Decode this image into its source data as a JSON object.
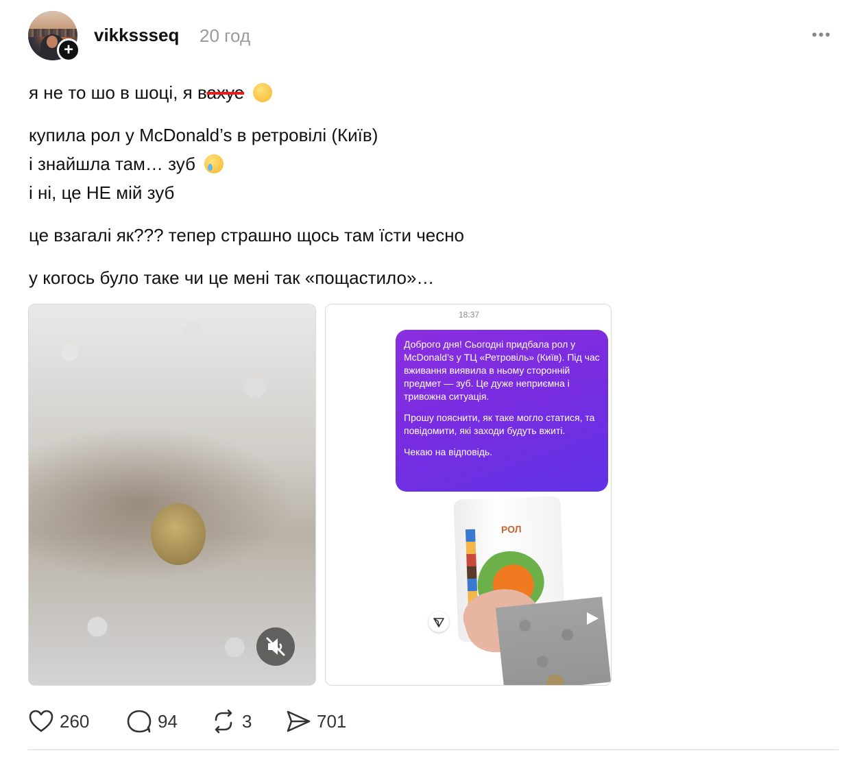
{
  "post": {
    "username": "vikkssseq",
    "timestamp": "20 год",
    "more_label": "•••",
    "follow_label": "+",
    "line1_before": "я не то шо в шоці, я в",
    "line1_struck": "ахуе",
    "line2": "купила рол у McDonald’s в ретровілі (Київ)",
    "line3": "і знайшла там… зуб",
    "line4": "і ні, це НЕ мій зуб",
    "line5": "це взагалі як??? тепер страшно щось там їсти чесно",
    "line6": "у когось було таке чи це мені так «пощастило»…"
  },
  "media": {
    "chat_time": "18:37",
    "message_paragraphs": [
      "Доброго дня! Сьогодні придбала рол у McDonald’s у ТЦ «Ретровіль» (Київ). Під час вживання виявила в ньому сторонній предмет — зуб. Це дуже неприємна і тривожна ситуація.",
      "Прошу пояснити, як таке могло статися, та повідомити, які заходи будуть вжиті.",
      "Чекаю на відповідь."
    ],
    "box_label": "РОЛ"
  },
  "actions": {
    "likes": "260",
    "replies": "94",
    "reposts": "3",
    "shares": "701"
  },
  "colors": {
    "bubble_purple": "#7a2ce0",
    "strike_red": "#e02020",
    "muted_gray": "#9a9a9a"
  },
  "icons": [
    "plus-icon",
    "more-icon",
    "melting-face-emoji",
    "crying-face-emoji",
    "mute-icon",
    "play-icon",
    "send-icon",
    "heart-icon",
    "comment-icon",
    "repost-icon",
    "share-icon"
  ]
}
